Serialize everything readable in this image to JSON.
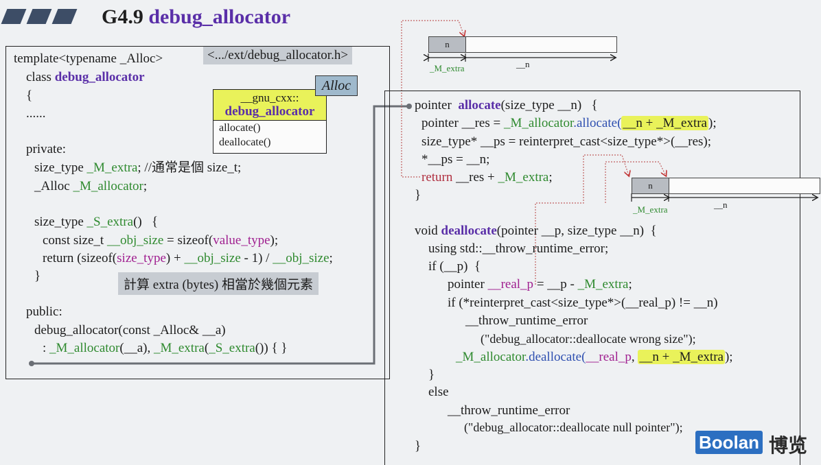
{
  "title": {
    "prefix": "G4.9 ",
    "highlight": "debug_allocator"
  },
  "left_panel": {
    "header_tag": "<.../ext/debug_allocator.h>",
    "alloc_tag": "Alloc",
    "uml": {
      "namespace": "__gnu_cxx::",
      "class_name": "debug_allocator",
      "methods": [
        "allocate()",
        "deallocate()"
      ]
    },
    "note": "計算 extra (bytes) 相當於幾個元素",
    "lines": {
      "l1": "template<typename _Alloc>",
      "l2a": "class ",
      "l2b": "debug_allocator",
      "l3": "{",
      "l4": "......",
      "l5": "private:",
      "l6a": "size_type ",
      "l6b": "_M_extra",
      "l6c": "; //通常是個 size_t;",
      "l7a": "_Alloc ",
      "l7b": "_M_allocator",
      "l7c": ";",
      "l8a": "size_type ",
      "l8b": "_S_extra",
      "l8c": "()   {",
      "l9a": "const size_t ",
      "l9b": "__obj_size",
      "l9c": " = sizeof(",
      "l9d": "value_type",
      "l9e": ");",
      "l10a": "return (sizeof(",
      "l10b": "size_type",
      "l10c": ") + ",
      "l10d": "__obj_size",
      "l10e": " - 1) / ",
      "l10f": "__obj_size",
      "l10g": ";",
      "l11": "}",
      "l12": "public:",
      "l13": "debug_allocator(const _Alloc& __a)",
      "l14a": ": ",
      "l14b": "_M_allocator",
      "l14c": "(__a), ",
      "l14d": "_M_extra",
      "l14e": "(",
      "l14f": "_S_extra",
      "l14g": "()) { }"
    }
  },
  "right_panel": {
    "lines": {
      "a1a": "pointer  ",
      "a1b": "allocate",
      "a1c": "(size_type __n)   {",
      "a2a": "pointer __res = ",
      "a2b": "_M_allocator",
      "a2c": ".allocate(",
      "a2d": "__n + _M_extra",
      "a2e": ");",
      "a3": "size_type* __ps = reinterpret_cast<size_type*>(__res);",
      "a4": "*__ps = __n;",
      "a5a": "return",
      "a5b": " __res + ",
      "a5c": "_M_extra",
      "a5d": ";",
      "a6": "}",
      "d1a": "void ",
      "d1b": "deallocate",
      "d1c": "(pointer __p, size_type __n)  {",
      "d2": "using std::__throw_runtime_error;",
      "d3": "if (__p)  {",
      "d4a": "pointer ",
      "d4b": "__real_p",
      "d4c": " = __p - ",
      "d4d": "_M_extra",
      "d4e": ";",
      "d5": "if (*reinterpret_cast<size_type*>(__real_p) != __n)",
      "d6": "__throw_runtime_error",
      "d7": "(\"debug_allocator::deallocate wrong size\");",
      "d8a": "_M_allocator",
      "d8b": ".deallocate(",
      "d8c": "__real_p",
      "d8d": ", ",
      "d8e": "__n + _M_extra",
      "d8f": ");",
      "d9": "}",
      "d10": "else",
      "d11": "__throw_runtime_error",
      "d12": "(\"debug_allocator::deallocate null pointer\");",
      "d13": "}"
    }
  },
  "diagrams": {
    "cell_label": "n",
    "extra_label": "_M_extra",
    "n_label": "__n"
  },
  "logo": {
    "text": "Boolan",
    "cn": "博览"
  }
}
